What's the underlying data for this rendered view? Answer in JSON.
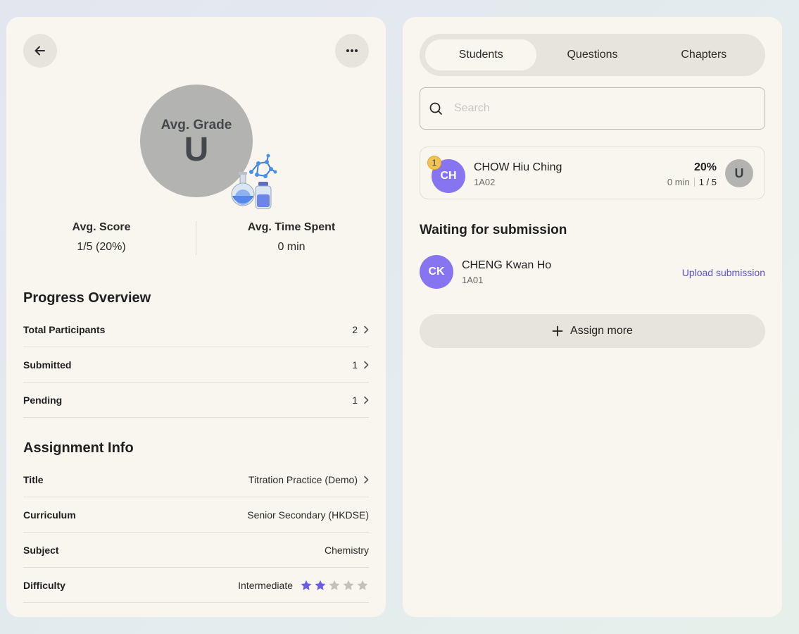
{
  "summary": {
    "grade_label": "Avg. Grade",
    "grade_value": "U",
    "avg_score_label": "Avg. Score",
    "avg_score_value": "1/5 (20%)",
    "avg_time_label": "Avg. Time Spent",
    "avg_time_value": "0 min"
  },
  "progress": {
    "title": "Progress Overview",
    "rows": [
      {
        "label": "Total Participants",
        "value": "2"
      },
      {
        "label": "Submitted",
        "value": "1"
      },
      {
        "label": "Pending",
        "value": "1"
      }
    ]
  },
  "assignment": {
    "title": "Assignment Info",
    "rows": [
      {
        "label": "Title",
        "value": "Titration Practice (Demo)"
      },
      {
        "label": "Curriculum",
        "value": "Senior Secondary (HKDSE)"
      },
      {
        "label": "Subject",
        "value": "Chemistry"
      },
      {
        "label": "Difficulty",
        "value": "Intermediate",
        "stars_filled": 2,
        "stars_total": 5
      }
    ]
  },
  "tabs": [
    {
      "label": "Students",
      "active": true
    },
    {
      "label": "Questions",
      "active": false
    },
    {
      "label": "Chapters",
      "active": false
    }
  ],
  "search": {
    "placeholder": "Search",
    "value": ""
  },
  "submitted_students": [
    {
      "rank": "1",
      "initials": "CH",
      "name": "CHOW Hiu Ching",
      "class": "1A02",
      "percent": "20%",
      "time": "0 min",
      "score": "1 / 5",
      "grade": "U"
    }
  ],
  "waiting": {
    "title": "Waiting for submission",
    "students": [
      {
        "initials": "CK",
        "name": "CHENG Kwan Ho",
        "class": "1A01",
        "action": "Upload submission"
      }
    ]
  },
  "assign_more_label": "Assign more",
  "colors": {
    "accent": "#8674f0",
    "link": "#5d4fe0",
    "star_filled": "#6c5ce7",
    "star_empty": "#c3c1b9",
    "rank_badge": "#f1c257",
    "panel_bg": "#f8f6ef",
    "chip_bg": "#e7e5db"
  },
  "icons": {
    "back": "arrow-left-icon",
    "more": "more-horizontal-icon",
    "chevron": "chevron-right-icon",
    "search": "search-icon",
    "plus": "plus-icon",
    "illustration": "chemistry-flask-icon"
  }
}
